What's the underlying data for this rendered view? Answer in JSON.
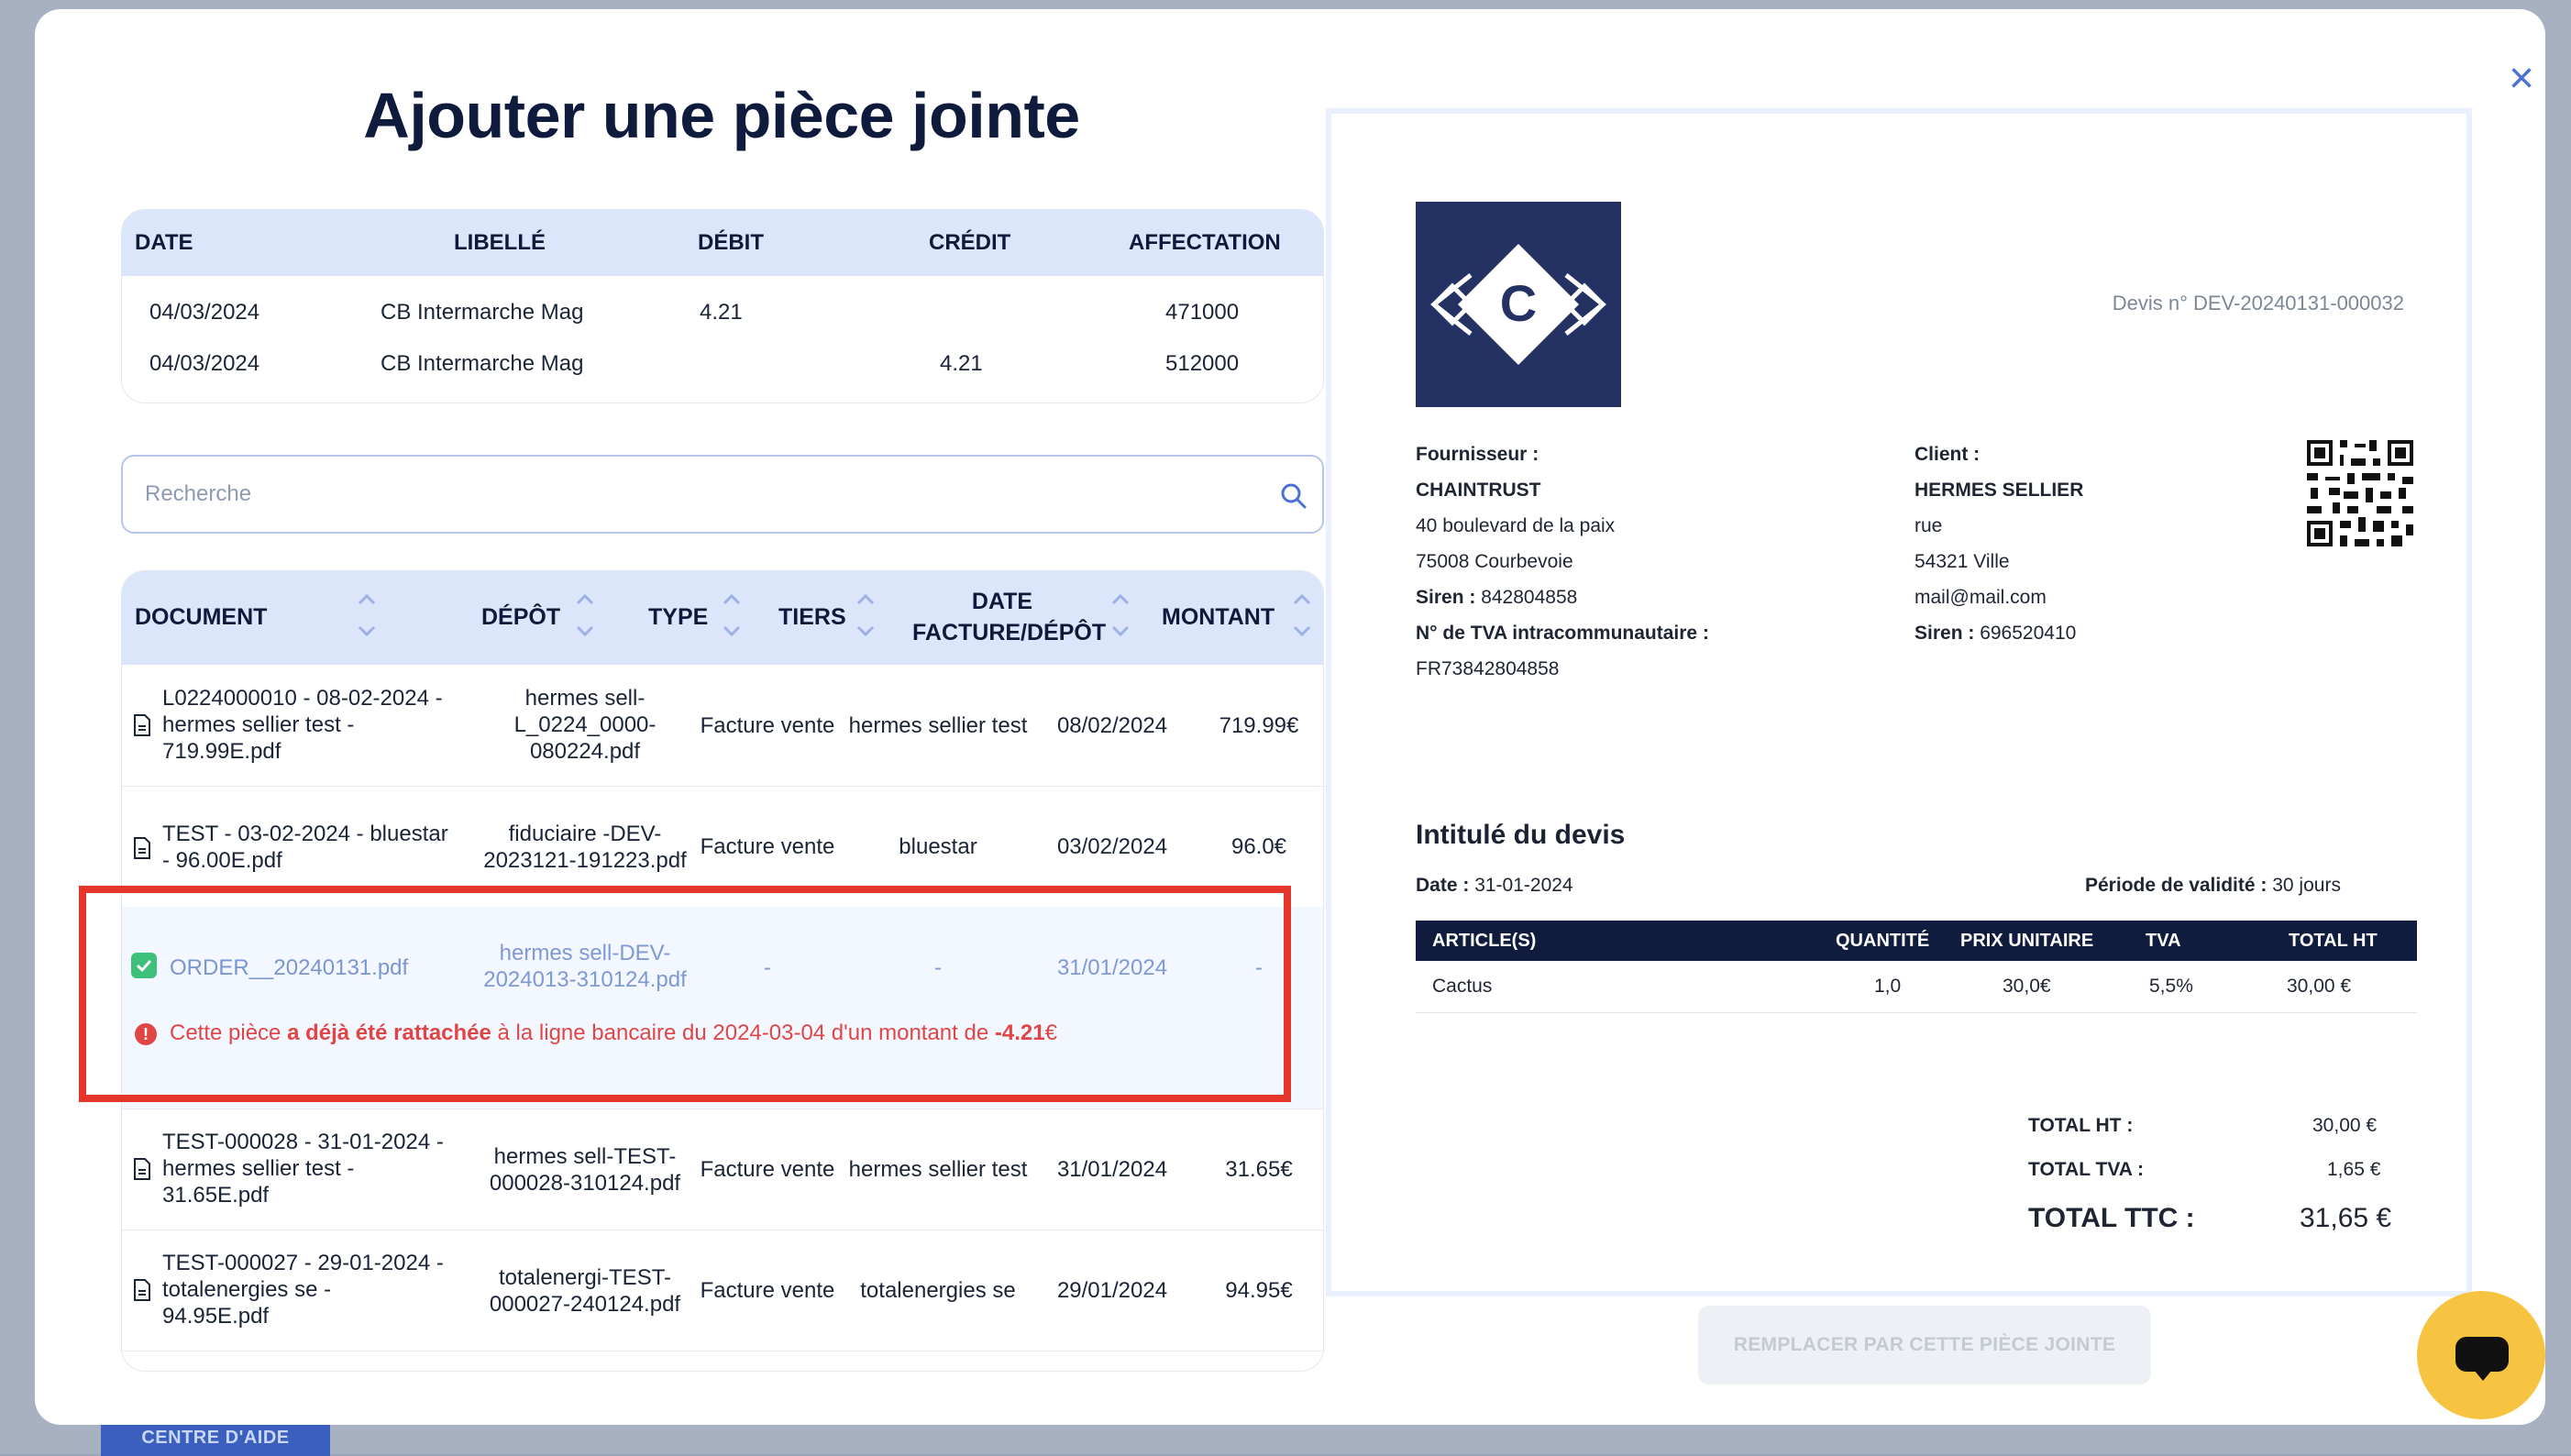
{
  "background": {
    "help_button": "CENTRE D'AIDE"
  },
  "modal": {
    "title": "Ajouter une pièce jointe",
    "close_icon": "close-icon"
  },
  "bank_table": {
    "headers": [
      "DATE",
      "LIBELLÉ",
      "DÉBIT",
      "CRÉDIT",
      "AFFECTATION"
    ],
    "rows": [
      {
        "date": "04/03/2024",
        "libelle": "CB Intermarche Mag",
        "debit": "4.21",
        "credit": "",
        "affectation": "471000"
      },
      {
        "date": "04/03/2024",
        "libelle": "CB Intermarche Mag",
        "debit": "",
        "credit": "4.21",
        "affectation": "512000"
      }
    ]
  },
  "search": {
    "placeholder": "Recherche",
    "value": ""
  },
  "docs_table": {
    "headers": {
      "document": "DOCUMENT",
      "depot": "DÉPÔT",
      "type": "TYPE",
      "tiers": "TIERS",
      "date_line1": "DATE",
      "date_line2": "FACTURE/DÉPÔT",
      "montant": "MONTANT"
    },
    "rows": [
      {
        "doc": [
          "L0224000010 - 08-02-2024 -",
          "hermes sellier test -",
          "719.99E.pdf"
        ],
        "depot": [
          "hermes sell-",
          "L_0224_0000-",
          "080224.pdf"
        ],
        "type": "Facture vente",
        "tiers": "hermes sellier test",
        "date": "08/02/2024",
        "montant": "719.99€"
      },
      {
        "doc": [
          "TEST - 03-02-2024 - bluestar",
          "- 96.00E.pdf"
        ],
        "depot": [
          "fiduciaire -DEV-",
          "2023121-191223.pdf"
        ],
        "type": "Facture vente",
        "tiers": "bluestar",
        "date": "03/02/2024",
        "montant": "96.0€"
      },
      {
        "doc": [
          "ORDER__20240131.pdf"
        ],
        "depot": [
          "hermes sell-DEV-",
          "2024013-310124.pdf"
        ],
        "type": "-",
        "tiers": "-",
        "date": "31/01/2024",
        "montant": "-",
        "selected": true,
        "warning": {
          "p1": "Cette pièce ",
          "p2": "a déjà été rattachée",
          "p3": " à la ligne bancaire du 2024-03-04 d'un montant de ",
          "p4": "-4.21",
          "p5": "€"
        }
      },
      {
        "doc": [
          "TEST-000028 - 31-01-2024 -",
          "hermes sellier test -",
          "31.65E.pdf"
        ],
        "depot": [
          "hermes sell-TEST-",
          "000028-310124.pdf"
        ],
        "type": "Facture vente",
        "tiers": "hermes sellier test",
        "date": "31/01/2024",
        "montant": "31.65€"
      },
      {
        "doc": [
          "TEST-000027 - 29-01-2024 -",
          "totalenergies se -",
          "94.95E.pdf"
        ],
        "depot": [
          "totalenergi-TEST-",
          "000027-240124.pdf"
        ],
        "type": "Facture vente",
        "tiers": "totalenergies se",
        "date": "29/01/2024",
        "montant": "94.95€"
      }
    ]
  },
  "preview": {
    "logo_letter": "C",
    "devis_number": "Devis n° DEV-20240131-000032",
    "fournisseur": {
      "label": "Fournisseur :",
      "name": "CHAINTRUST",
      "address1": "40 boulevard de la paix",
      "address2": "75008 Courbevoie",
      "siren_label": "Siren :",
      "siren": " 842804858",
      "tva_label": "N° de TVA intracommunautaire :",
      "tva": "FR73842804858"
    },
    "client": {
      "label": "Client :",
      "name": "HERMES SELLIER",
      "address1": "rue",
      "address2": "54321 Ville",
      "email": "mail@mail.com",
      "siren_label": "Siren :",
      "siren": " 696520410"
    },
    "intitule": "Intitulé du devis",
    "date_label": "Date :",
    "date": " 31-01-2024",
    "validite_label": "Période de validité :",
    "validite": " 30 jours",
    "articles_headers": [
      "ARTICLE(S)",
      "QUANTITÉ",
      "PRIX UNITAIRE",
      "TVA",
      "TOTAL HT"
    ],
    "articles": [
      {
        "name": "Cactus",
        "qty": "1,0",
        "unit": "30,0€",
        "tva": "5,5%",
        "total": "30,00 €"
      }
    ],
    "totals": {
      "ht_label": "TOTAL HT :",
      "ht": "30,00 €",
      "tva_label": "TOTAL TVA :",
      "tva": "1,65 €",
      "ttc_label": "TOTAL TTC :",
      "ttc": "31,65 €"
    }
  },
  "actions": {
    "replace_button": "REMPLACER PAR CETTE PIÈCE JOINTE",
    "chat_icon": "chat-bubble-icon"
  },
  "colors": {
    "header_bg": "#dce6fa",
    "highlight": "#e5362b",
    "navy": "#0f1c3d",
    "chat": "#f6c441"
  }
}
